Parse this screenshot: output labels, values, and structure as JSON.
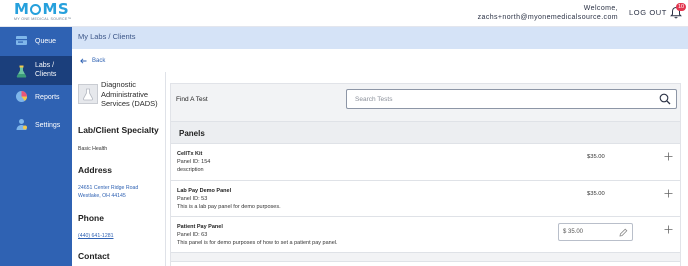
{
  "brand": {
    "logo_text": "MOMS",
    "logo_subtitle": "MY ONE MEDICAL SOURCE™",
    "color": "#26a0dc"
  },
  "header": {
    "welcome_label": "Welcome,",
    "user_email": "zachs+north@myonemedicalsource.com",
    "logout_label": "LOG OUT",
    "notification_count": "10"
  },
  "sidebar": {
    "background": "#2f62b3",
    "items": [
      {
        "label": "Queue",
        "icon": "queue-icon",
        "active": false
      },
      {
        "label": "Labs /\nClients",
        "icon": "flask-icon",
        "active": true
      },
      {
        "label": "Reports",
        "icon": "pie-chart-icon",
        "active": false
      },
      {
        "label": "Settings",
        "icon": "settings-icon",
        "active": false
      }
    ]
  },
  "breadcrumb": "My Labs / Clients",
  "back_label": "Back",
  "client": {
    "name": "Diagnostic Administrative Services (DADS)",
    "specialty_title": "Lab/Client Specialty",
    "specialty_value": "Basic Health",
    "address_title": "Address",
    "address_line1": "24651 Center Ridge Road",
    "address_line2": "Westlake, OH 44145",
    "phone_title": "Phone",
    "phone_value": "(440) 641-1281",
    "contact_title": "Contact"
  },
  "tests": {
    "find_label": "Find A Test",
    "search_placeholder": "Search Tests",
    "panels_title": "Panels",
    "rows": [
      {
        "name": "CellTx Kit",
        "panel_id": "Panel ID: 154",
        "description": "description",
        "price": "$35.00"
      },
      {
        "name": "Lab Pay Demo Panel",
        "panel_id": "Panel ID: 53",
        "description": "This is a lab pay panel for demo purposes.",
        "price": "$35.00"
      },
      {
        "name": "Patient Pay Panel",
        "panel_id": "Panel ID: 63",
        "description": "This panel is for demo purposes of how to set a patient pay panel.",
        "price_input": "$ 35.00"
      }
    ]
  }
}
